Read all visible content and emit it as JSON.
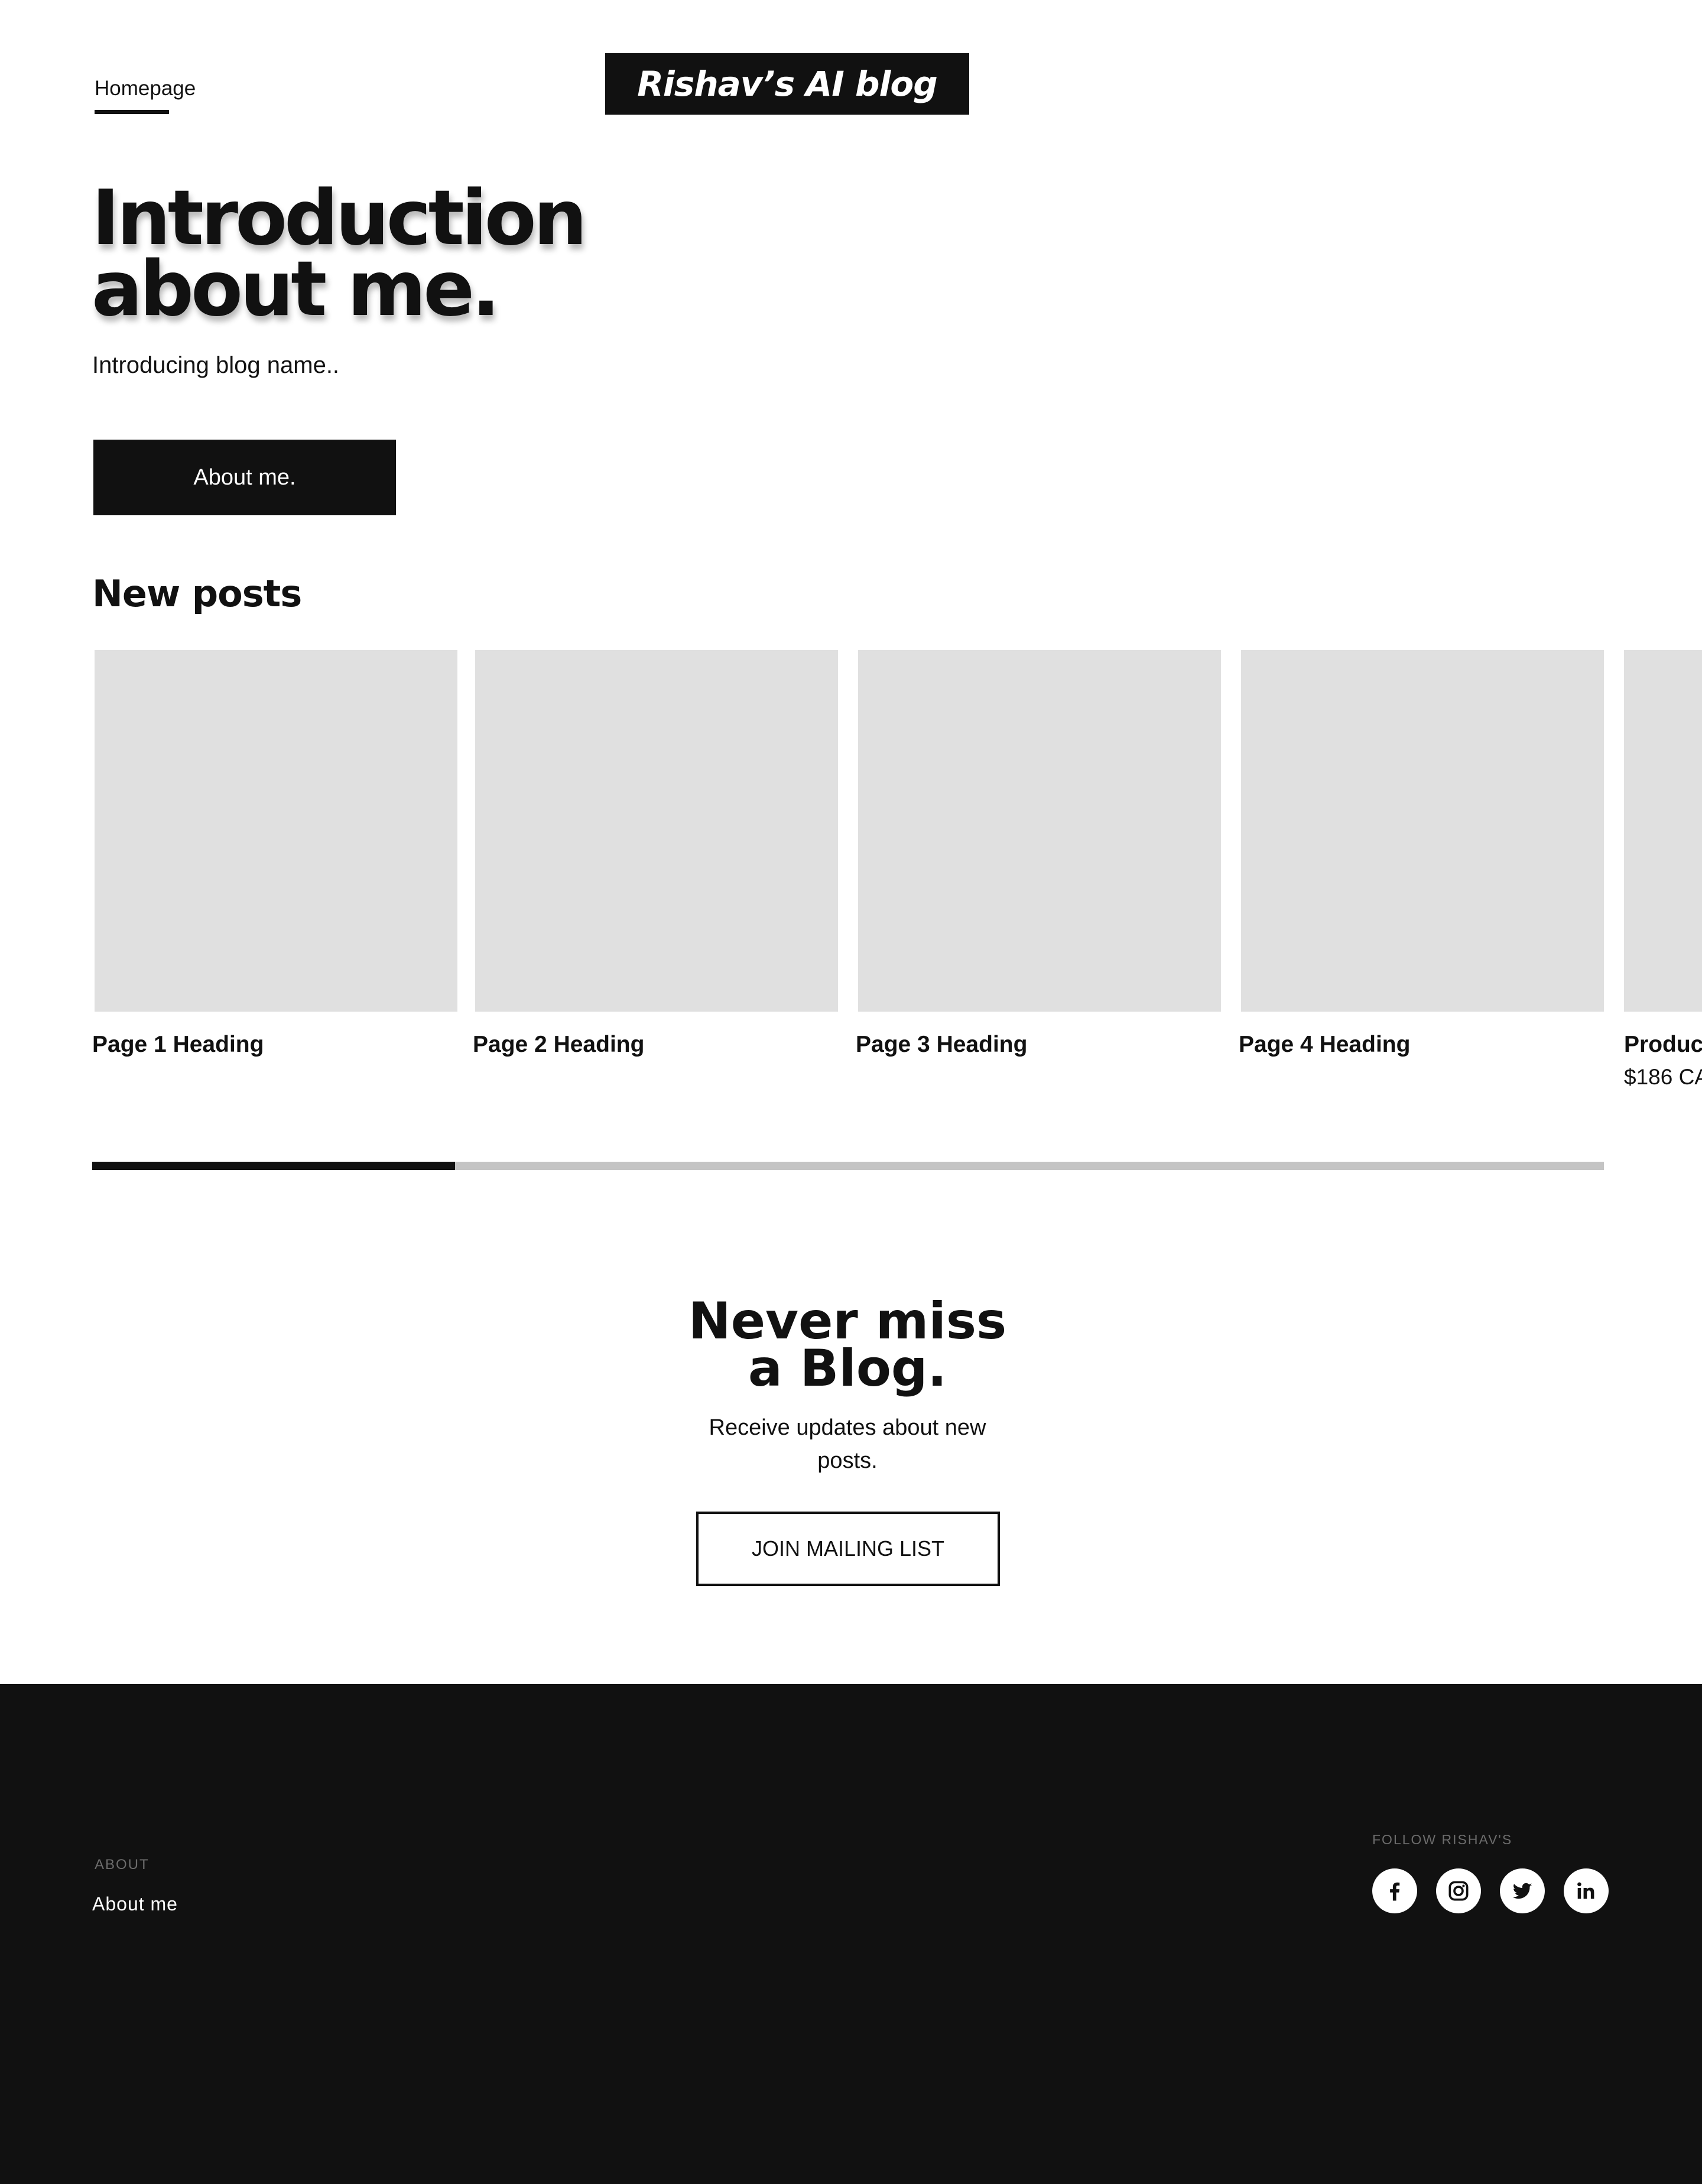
{
  "header": {
    "nav_link": "Homepage",
    "logo": "Rishav’s AI blog"
  },
  "hero": {
    "title_line1": "Introduction",
    "title_line2": "about me.",
    "subtitle": "Introducing blog name..",
    "button": "About me."
  },
  "new_posts": {
    "title": "New posts",
    "cards": [
      {
        "heading": "Page 1 Heading"
      },
      {
        "heading": "Page 2 Heading"
      },
      {
        "heading": "Page 3 Heading"
      },
      {
        "heading": "Page 4 Heading"
      },
      {
        "heading": "Product",
        "price": "$186 CA"
      }
    ],
    "scroll_progress": 0.24
  },
  "newsletter": {
    "title_line1": "Never miss",
    "title_line2": "a Blog.",
    "subtitle": "Receive updates about new posts.",
    "button": "JOIN MAILING LIST"
  },
  "footer": {
    "about_label": "ABOUT",
    "about_link": "About me",
    "follow_label": "FOLLOW RISHAV'S",
    "social_icons": [
      "facebook-icon",
      "instagram-icon",
      "twitter-icon",
      "linkedin-icon"
    ]
  },
  "colors": {
    "primary": "#111111",
    "card_placeholder": "#e0e0e0",
    "scroll_track": "#c4c4c4",
    "footer_background": "#111111",
    "footer_label": "#6c6c6c"
  }
}
